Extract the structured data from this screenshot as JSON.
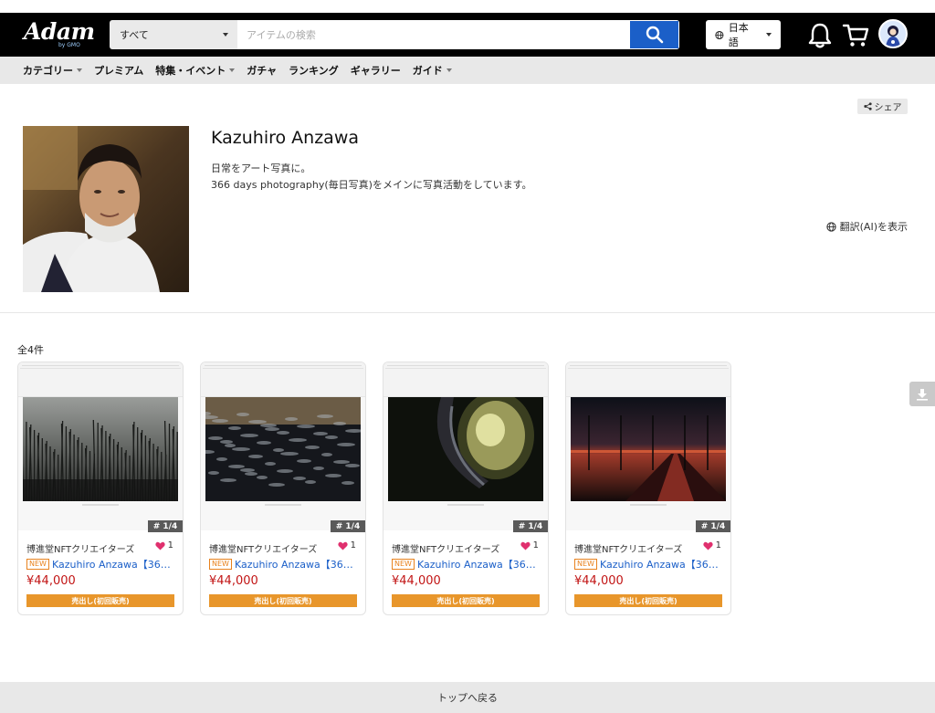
{
  "header": {
    "logo_text": "Adam",
    "logo_sub": "by GMO",
    "category_select": "すべて",
    "search_placeholder": "アイテムの検索",
    "language": "日本語",
    "accent": "#1b5fc8"
  },
  "nav": {
    "items": [
      {
        "label": "カテゴリー",
        "dropdown": true
      },
      {
        "label": "プレミアム",
        "dropdown": false
      },
      {
        "label": "特集・イベント",
        "dropdown": true
      },
      {
        "label": "ガチャ",
        "dropdown": false
      },
      {
        "label": "ランキング",
        "dropdown": false
      },
      {
        "label": "ギャラリー",
        "dropdown": false
      },
      {
        "label": "ガイド",
        "dropdown": true
      }
    ]
  },
  "profile": {
    "share_label": "シェア",
    "name": "Kazuhiro Anzawa",
    "bio_line1": "日常をアート写真に。",
    "bio_line2": "366 days photography(毎日写真)をメインに写真活動をしています。",
    "translate_label": "翻訳(AI)を表示"
  },
  "listing": {
    "count_label": "全4件",
    "items": [
      {
        "edition": "# 1/4",
        "creator": "博進堂NFTクリエイターズ",
        "likes": "1",
        "new": "NEW",
        "title": "Kazuhiro Anzawa【36…",
        "price": "¥44,000",
        "sale": "売出し(初回販売)",
        "scene": "grass"
      },
      {
        "edition": "# 1/4",
        "creator": "博進堂NFTクリエイターズ",
        "likes": "1",
        "new": "NEW",
        "title": "Kazuhiro Anzawa【36…",
        "price": "¥44,000",
        "sale": "売出し(初回販売)",
        "scene": "water"
      },
      {
        "edition": "# 1/4",
        "creator": "博進堂NFTクリエイターズ",
        "likes": "1",
        "new": "NEW",
        "title": "Kazuhiro Anzawa【36…",
        "price": "¥44,000",
        "sale": "売出し(初回販売)",
        "scene": "lamp"
      },
      {
        "edition": "# 1/4",
        "creator": "博進堂NFTクリエイターズ",
        "likes": "1",
        "new": "NEW",
        "title": "Kazuhiro Anzawa【36…",
        "price": "¥44,000",
        "sale": "売出し(初回販売)",
        "scene": "sunset"
      }
    ]
  },
  "footer": {
    "back_to_top": "トップへ戻る"
  },
  "icons": {
    "search": "search-icon",
    "globe": "globe-icon",
    "bell": "bell-icon",
    "cart": "cart-icon",
    "share": "share-icon",
    "heart": "heart-icon",
    "download": "download-icon"
  }
}
